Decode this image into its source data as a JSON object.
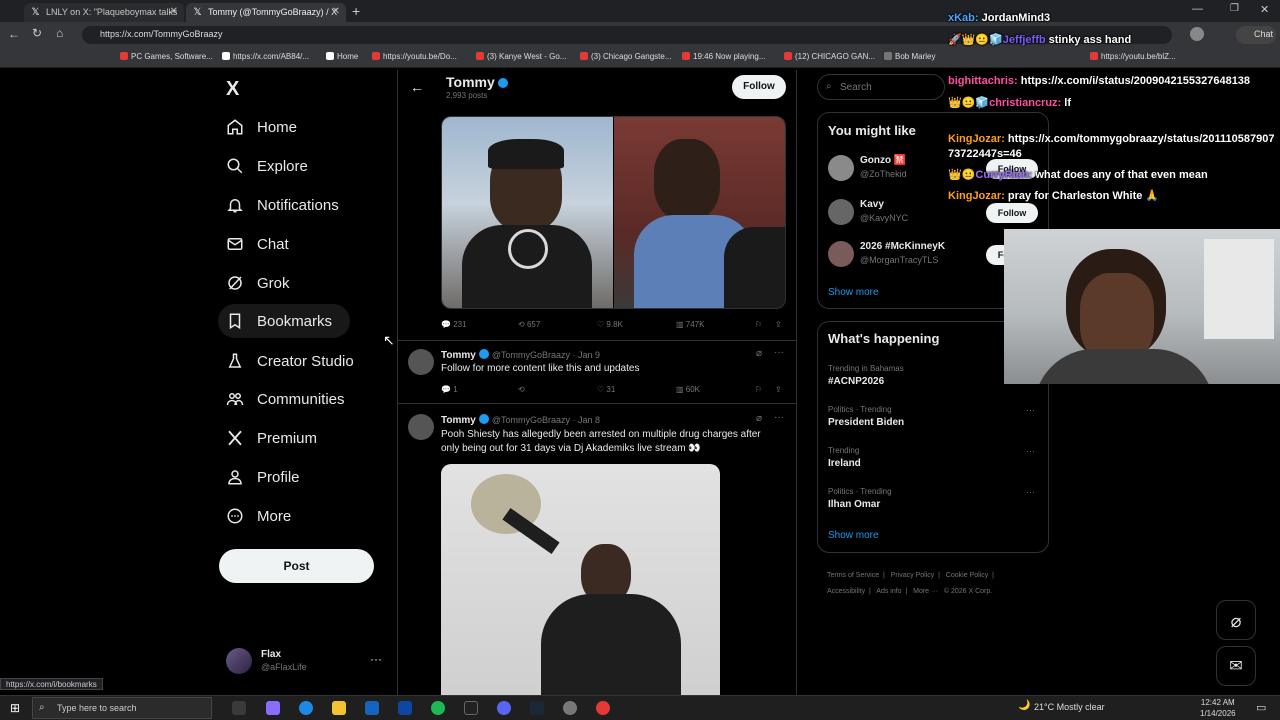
{
  "browser": {
    "tabs": [
      {
        "title": "LNLY on X: \"Plaqueboymax talks"
      },
      {
        "title": "Tommy (@TommyGoBraazy) / X"
      }
    ],
    "new_tab": "+",
    "url": "https://x.com/TommyGoBraazy",
    "bookmarks": [
      "PC Games, Software...",
      "https://x.com/AB84/...",
      "Home",
      "https://youtu.be/Do...",
      "(3) Kanye West - Go...",
      "(3) Chicago Gangste...",
      "19:46 Now playing...",
      "(12) CHICAGO GAN...",
      "Bob Marley",
      "https://youtu.be/blZ..."
    ],
    "chat_label": "Chat",
    "status_url": "https://x.com/i/bookmarks"
  },
  "sidebar": {
    "logo": "X",
    "items": [
      {
        "label": "Home",
        "icon": "home-icon"
      },
      {
        "label": "Explore",
        "icon": "search-icon"
      },
      {
        "label": "Notifications",
        "icon": "bell-icon"
      },
      {
        "label": "Chat",
        "icon": "mail-icon"
      },
      {
        "label": "Grok",
        "icon": "grok-icon"
      },
      {
        "label": "Bookmarks",
        "icon": "bookmark-icon"
      },
      {
        "label": "Creator Studio",
        "icon": "flask-icon"
      },
      {
        "label": "Communities",
        "icon": "people-icon"
      },
      {
        "label": "Premium",
        "icon": "x-icon"
      },
      {
        "label": "Profile",
        "icon": "person-icon"
      },
      {
        "label": "More",
        "icon": "more-circle-icon"
      }
    ],
    "post_label": "Post",
    "account": {
      "name": "Flax",
      "handle": "@aFlaxLife",
      "menu": "···"
    }
  },
  "profile_header": {
    "name": "Tommy",
    "posts": "2,993 posts",
    "follow_label": "Follow"
  },
  "tweets": [
    {
      "stats": {
        "replies": "231",
        "reposts": "657",
        "likes": "9.8K",
        "views": "747K"
      }
    },
    {
      "name": "Tommy",
      "handle": "@TommyGoBraazy",
      "date": "· Jan 9",
      "text": "Follow for more content like this and updates",
      "stats": {
        "replies": "1",
        "reposts": "",
        "likes": "31",
        "views": "60K"
      }
    },
    {
      "name": "Tommy",
      "handle": "@TommyGoBraazy",
      "date": "· Jan 8",
      "text_line1": "Pooh Shiesty has allegedly been arrested on multiple drug charges after",
      "text_line2": "only being out for 31 days via Dj Akademiks live stream 👀"
    }
  ],
  "search": {
    "placeholder": "Search"
  },
  "who_to_follow": {
    "title": "You might like",
    "users": [
      {
        "name": "Gonzo 🈲",
        "handle": "@ZoThekid",
        "button": "Follow"
      },
      {
        "name": "Kavy",
        "handle": "@KavyNYC",
        "button": "Follow"
      },
      {
        "name": "2026 #McKinneyK",
        "handle": "@MorganTracyTLS",
        "button": "Follow"
      }
    ],
    "show_more": "Show more"
  },
  "trending": {
    "title": "What's happening",
    "items": [
      {
        "context": "Trending in Bahamas",
        "topic": "#ACNP2026"
      },
      {
        "context": "Politics · Trending",
        "topic": "President Biden"
      },
      {
        "context": "Trending",
        "topic": "Ireland"
      },
      {
        "context": "Politics · Trending",
        "topic": "Ilhan Omar"
      }
    ],
    "show_more": "Show more"
  },
  "footer_links": [
    "Terms of Service",
    "Privacy Policy",
    "Cookie Policy",
    "Accessibility",
    "Ads info",
    "More ···",
    "© 2026 X Corp."
  ],
  "stream_chat": [
    {
      "user": "xKab:",
      "msg": "JordanMind3",
      "color": "#4aa3ff"
    },
    {
      "user": "Jeffjeffb",
      "msg": "stinky ass hand",
      "color": "#7b5cff"
    },
    {
      "user": "bighittachris:",
      "msg": "https://x.com/i/status/2009042155327648138",
      "color": "#ff4fa0"
    },
    {
      "user": "christiancruz:",
      "msg": "lf",
      "color": "#ff4fa0"
    },
    {
      "user": "KingJozar:",
      "msg": "https://x.com/tommygobraazy/status/201110587907",
      "msg2": "73722447s=46",
      "color": "#ff9f1c"
    },
    {
      "user": "CurryRich:",
      "msg": "what does any of that even mean",
      "color": "#9b6cff"
    },
    {
      "user": "KingJozar:",
      "msg": "pray for Charleston White 🙏",
      "color": "#ff9f1c"
    }
  ],
  "taskbar": {
    "search_placeholder": "Type here to search",
    "weather": "21°C  Mostly clear",
    "time": "12:42 AM",
    "date": "1/14/2026"
  }
}
